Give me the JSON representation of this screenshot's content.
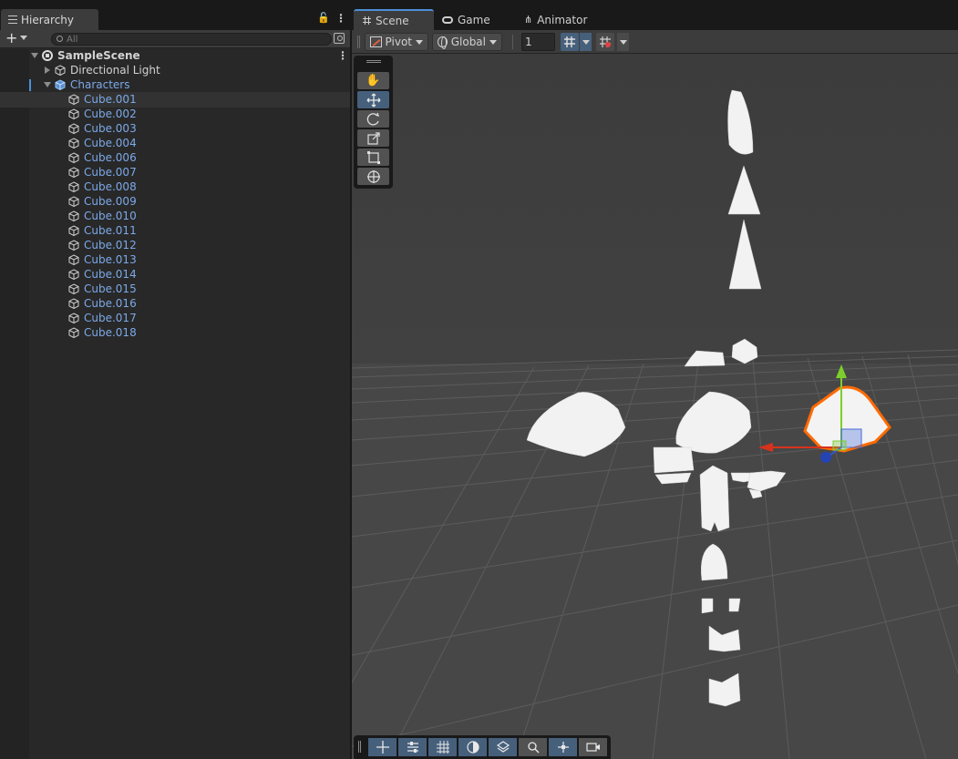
{
  "hierarchy": {
    "tab_label": "Hierarchy",
    "search_placeholder": "All",
    "scene_name": "SampleScene",
    "items": [
      {
        "label": "Directional Light"
      },
      {
        "label": "Characters"
      }
    ],
    "children": [
      "Cube.001",
      "Cube.002",
      "Cube.003",
      "Cube.004",
      "Cube.006",
      "Cube.007",
      "Cube.008",
      "Cube.009",
      "Cube.010",
      "Cube.011",
      "Cube.012",
      "Cube.013",
      "Cube.014",
      "Cube.015",
      "Cube.016",
      "Cube.017",
      "Cube.018"
    ]
  },
  "scene_view": {
    "tabs": [
      {
        "label": "Scene"
      },
      {
        "label": "Game"
      },
      {
        "label": "Animator"
      }
    ],
    "toolbar": {
      "pivot_label": "Pivot",
      "global_label": "Global",
      "snap_value": "1"
    }
  },
  "colors": {
    "accent": "#4a90d9",
    "selected_toggle": "#46607c",
    "prefab_blue": "#7ca9e8",
    "selection_outline": "#ff6a00"
  }
}
